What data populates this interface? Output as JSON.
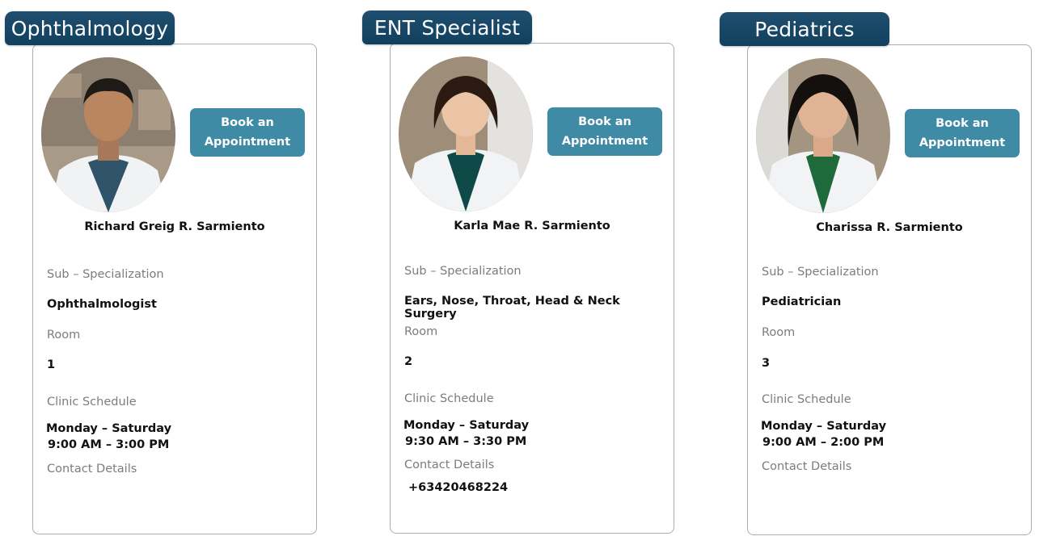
{
  "labels": {
    "sub_specialization": "Sub – Specialization",
    "room": "Room",
    "clinic_schedule": "Clinic Schedule",
    "contact_details": "Contact Details",
    "book_button": "Book an\nAppointment"
  },
  "colors": {
    "tab": "#1f4e6e",
    "button": "#3f8aa5",
    "card_border": "#a9acb1"
  },
  "doctors": [
    {
      "specialty": "Ophthalmology",
      "name": "Richard Greig R. Sarmiento",
      "sub_specialization": "Ophthalmologist",
      "room": "1",
      "schedule_days": "Monday – Saturday",
      "schedule_time": "9:00 AM – 3:00 PM",
      "contact": ""
    },
    {
      "specialty": "ENT Specialist",
      "name": "Karla Mae R. Sarmiento",
      "sub_specialization": "Ears, Nose, Throat, Head & Neck Surgery",
      "room": "2",
      "schedule_days": "Monday – Saturday",
      "schedule_time": "9:30 AM – 3:30 PM",
      "contact": "+63420468224"
    },
    {
      "specialty": "Pediatrics",
      "name": "Charissa R. Sarmiento",
      "sub_specialization": "Pediatrician",
      "room": "3",
      "schedule_days": "Monday – Saturday",
      "schedule_time": "9:00 AM – 2:00 PM",
      "contact": ""
    }
  ]
}
